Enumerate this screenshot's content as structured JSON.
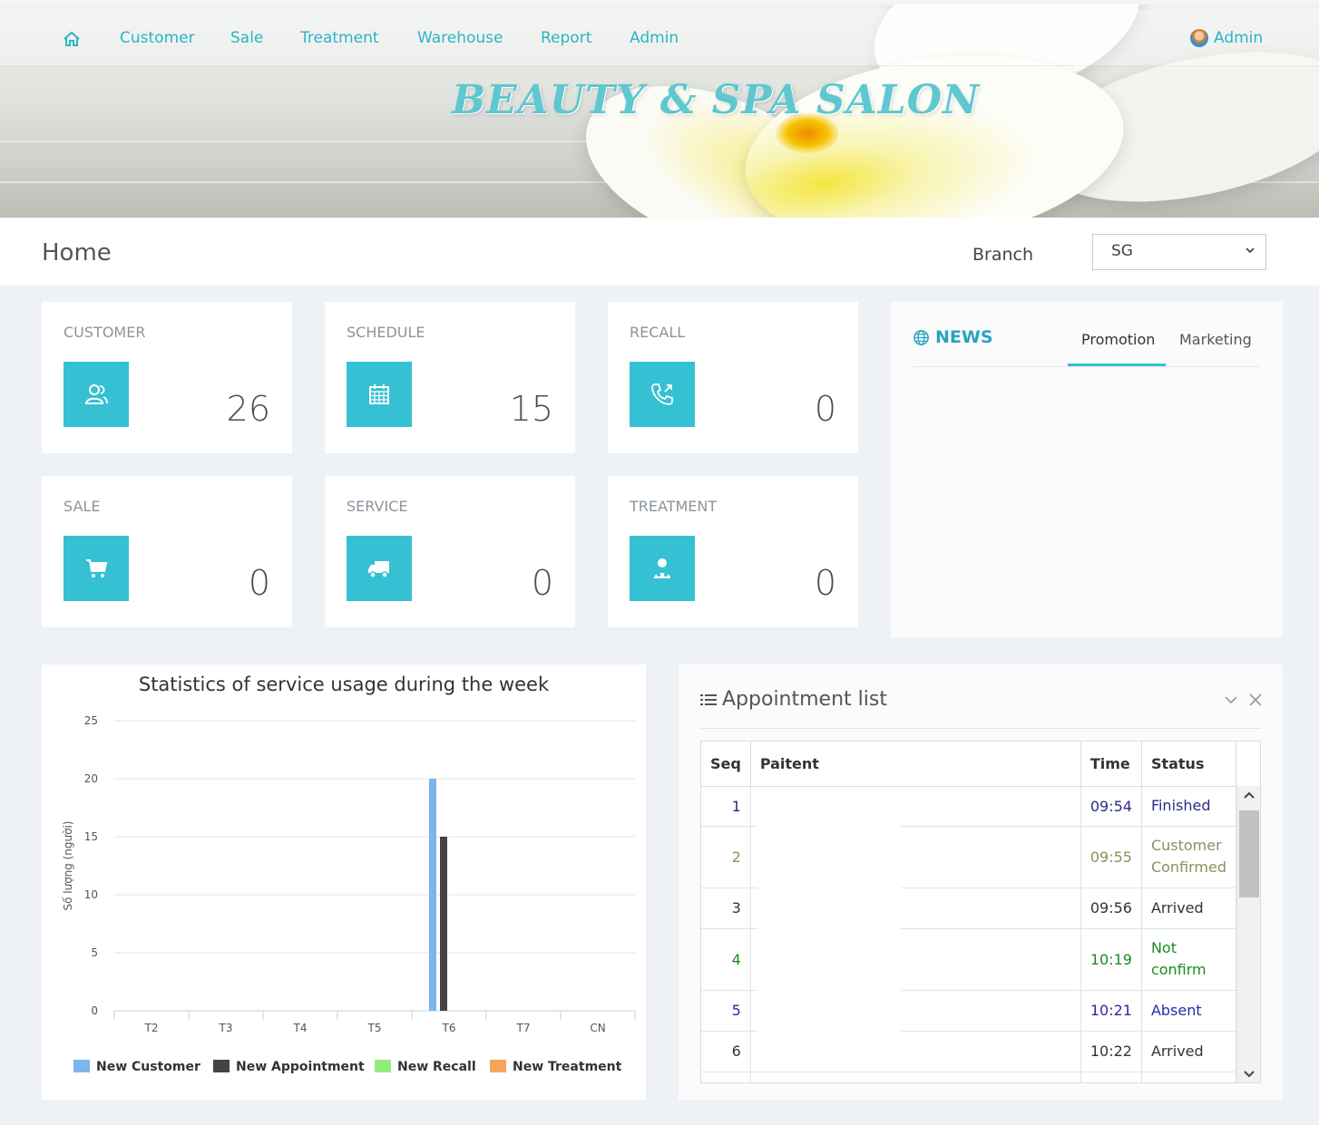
{
  "nav": {
    "items": [
      "Customer",
      "Sale",
      "Treatment",
      "Warehouse",
      "Report",
      "Admin"
    ],
    "user": "Admin",
    "home_icon": "home-icon"
  },
  "brand": "BEAUTY & SPA SALON",
  "header": {
    "title": "Home",
    "branch_label": "Branch",
    "branch_value": "SG"
  },
  "cards": [
    {
      "title": "CUSTOMER",
      "value": "26",
      "icon": "users-icon"
    },
    {
      "title": "SCHEDULE",
      "value": "15",
      "icon": "calendar-icon"
    },
    {
      "title": "RECALL",
      "value": "0",
      "icon": "phone-icon"
    },
    {
      "title": "SALE",
      "value": "0",
      "icon": "cart-icon"
    },
    {
      "title": "SERVICE",
      "value": "0",
      "icon": "truck-icon"
    },
    {
      "title": "TREATMENT",
      "value": "0",
      "icon": "doctor-icon"
    }
  ],
  "news": {
    "title": "NEWS",
    "tabs": [
      "Promotion",
      "Marketing"
    ],
    "active_tab": "Promotion"
  },
  "chart_data": {
    "type": "bar",
    "title": "Statistics of service usage during the week",
    "xlabel": "",
    "ylabel": "Số lượng (người)",
    "categories": [
      "T2",
      "T3",
      "T4",
      "T5",
      "T6",
      "T7",
      "CN"
    ],
    "ylim": [
      0,
      25
    ],
    "yticks": [
      0,
      5,
      10,
      15,
      20,
      25
    ],
    "grid": true,
    "legend_position": "bottom",
    "series": [
      {
        "name": "New Customer",
        "color": "#7cb5ec",
        "values": [
          0,
          0,
          0,
          0,
          20,
          0,
          0
        ]
      },
      {
        "name": "New Appointment",
        "color": "#434348",
        "values": [
          0,
          0,
          0,
          0,
          15,
          0,
          0
        ]
      },
      {
        "name": "New Recall",
        "color": "#90ed7d",
        "values": [
          0,
          0,
          0,
          0,
          0,
          0,
          0
        ]
      },
      {
        "name": "New Treatment",
        "color": "#f7a35c",
        "values": [
          0,
          0,
          0,
          0,
          0,
          0,
          0
        ]
      }
    ]
  },
  "appointments": {
    "title": "Appointment list",
    "columns": [
      "Seq",
      "Paitent",
      "Time",
      "Status"
    ],
    "rows": [
      {
        "seq": "1",
        "patient": "",
        "time": "09:54",
        "status": "Finished",
        "color": "#2a2a8a"
      },
      {
        "seq": "2",
        "patient": "",
        "time": "09:55",
        "status": "Customer Confirmed",
        "color": "#8f8f5f"
      },
      {
        "seq": "3",
        "patient": "",
        "time": "09:56",
        "status": "Arrived",
        "color": "#333333"
      },
      {
        "seq": "4",
        "patient": "",
        "time": "10:19",
        "status": "Not confirm",
        "color": "#1e8a1e"
      },
      {
        "seq": "5",
        "patient": "",
        "time": "10:21",
        "status": "Absent",
        "color": "#2a2aa8"
      },
      {
        "seq": "6",
        "patient": "",
        "time": "10:22",
        "status": "Arrived",
        "color": "#333333"
      }
    ]
  },
  "colors": {
    "accent": "#35c1d3",
    "nav_text": "#2ab4c7"
  }
}
